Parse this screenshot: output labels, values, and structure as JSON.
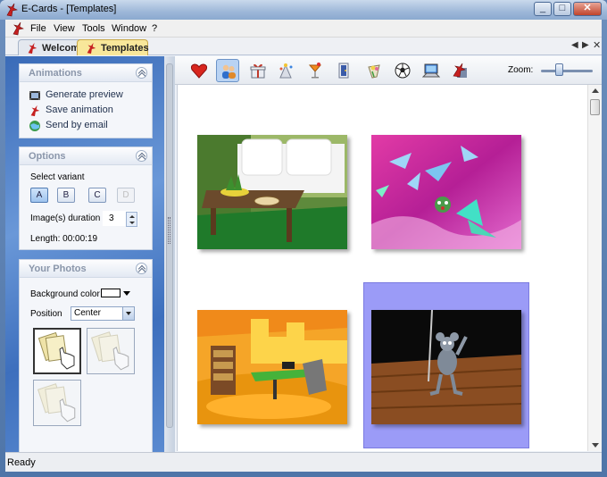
{
  "window": {
    "title": "E-Cards - [Templates]"
  },
  "menu": {
    "items": [
      "File",
      "View",
      "Tools",
      "Window",
      "?"
    ]
  },
  "tabs": [
    {
      "label": "Welcome",
      "active": false
    },
    {
      "label": "Templates",
      "active": true
    }
  ],
  "panel": {
    "animations": {
      "title": "Animations",
      "links": [
        "Generate preview",
        "Save animation",
        "Send by email"
      ]
    },
    "options": {
      "title": "Options",
      "select_variant_label": "Select variant",
      "variants": [
        {
          "label": "A",
          "state": "selected"
        },
        {
          "label": "B",
          "state": "normal"
        },
        {
          "label": "C",
          "state": "normal"
        },
        {
          "label": "D",
          "state": "disabled"
        }
      ],
      "duration_label": "Image(s) duration",
      "duration_value": "3",
      "length_text": "Length: 00:00:19"
    },
    "photos": {
      "title": "Your Photos",
      "bg_color_label": "Background color",
      "bg_color_value": "#ffffff",
      "position_label": "Position",
      "position_value": "Center"
    }
  },
  "toolbar": {
    "icons": [
      "heart-icon",
      "people-icon",
      "gift-icon",
      "party-icon",
      "cocktail-icon",
      "door-icon",
      "flowers-icon",
      "soccer-ball-icon",
      "computer-icon",
      "e-cards-logo-icon"
    ],
    "selected_index": 1,
    "zoom_label": "Zoom:",
    "zoom_level": 0.45
  },
  "templates": [
    {
      "name": "living-room-template",
      "selected": false
    },
    {
      "name": "butterflies-template",
      "selected": false
    },
    {
      "name": "office-template",
      "selected": false
    },
    {
      "name": "mouse-puppet-template",
      "selected": true
    }
  ],
  "status": {
    "text": "Ready"
  },
  "colors": {
    "accent": "#f8e79a",
    "selection": "#9b9bf7",
    "panel_blue": "#3a6bb8"
  }
}
